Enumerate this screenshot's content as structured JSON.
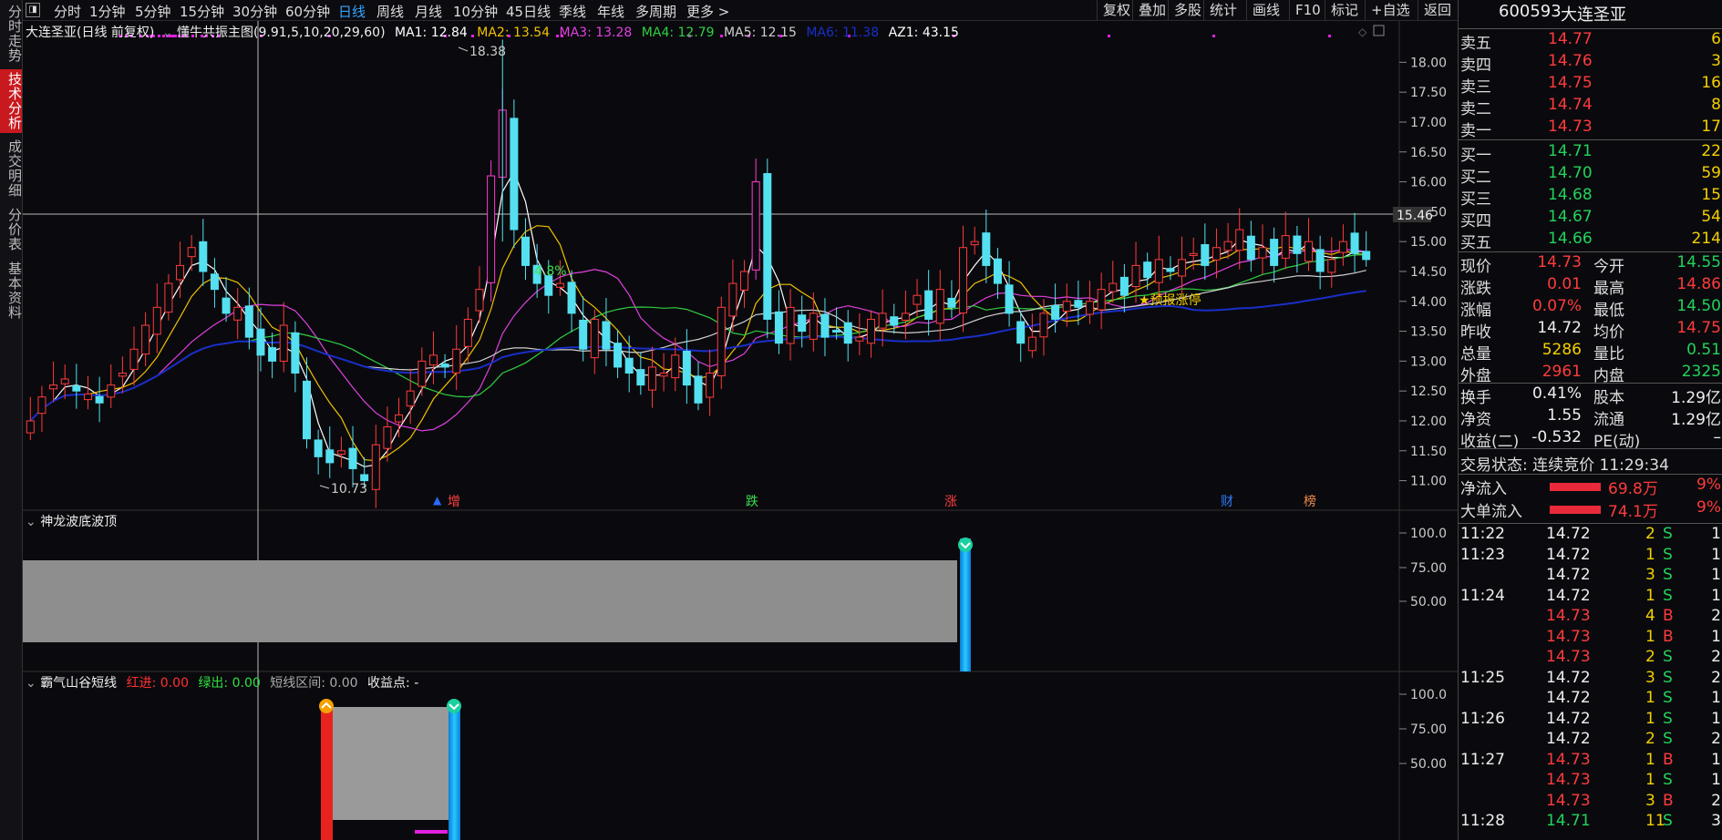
{
  "left_tabs": [
    "分时走势",
    "技术分析",
    "成交明细",
    "分价表",
    "基本资料"
  ],
  "topbar": {
    "periods": [
      "分时",
      "1分钟",
      "5分钟",
      "15分钟",
      "30分钟",
      "60分钟",
      "日线",
      "周线",
      "月线",
      "10分钟",
      "45日线",
      "季线",
      "年线",
      "多周期",
      "更多 >"
    ],
    "selected": "日线",
    "right_buttons": [
      "复权",
      "叠加",
      "多股",
      "统计",
      "画线",
      "F10",
      "标记",
      "+自选",
      "返回"
    ]
  },
  "main_chart": {
    "stock_name": "大连圣亚(日线 前复权)",
    "indicator": "懂牛共振主图(9.91,5,10,20,29,60)",
    "ma": [
      {
        "label": "MA1: 12.84",
        "color": "#ffffff"
      },
      {
        "label": "MA2: 13.54",
        "color": "#f0c000"
      },
      {
        "label": "MA3: 13.28",
        "color": "#e040e0"
      },
      {
        "label": "MA4: 12.79",
        "color": "#30d040"
      },
      {
        "label": "MA5: 12.15",
        "color": "#d0d0d0"
      },
      {
        "label": "MA6: 11.38",
        "color": "#1a2ec8"
      },
      {
        "label": "AZ1: 43.15",
        "color": "#ffffff"
      }
    ],
    "y_axis": [
      "18.00",
      "17.50",
      "17.00",
      "16.50",
      "16.00",
      "15.50",
      "15.00",
      "14.50",
      "14.00",
      "13.50",
      "13.00",
      "12.50",
      "12.00",
      "11.50",
      "11.00"
    ],
    "current_price_tag": "15.46",
    "high_label": "18.38",
    "low_label": "10.73",
    "pct_label": "4.8%",
    "signal_text": "★预报涨停",
    "bottom_markers": [
      "增",
      "跌",
      "涨",
      "财",
      "榜"
    ]
  },
  "pane2": {
    "title": "神龙波底波顶",
    "y_axis": [
      "100.0",
      "75.00",
      "50.00"
    ]
  },
  "pane3": {
    "title": "霸气山谷短线",
    "red_label": "红进: 0.00",
    "green_label": "绿出: 0.00",
    "range_label": "短线区间: 0.00",
    "profit_label": "收益点: -",
    "y_axis": [
      "100.0",
      "75.00",
      "50.00"
    ]
  },
  "quote": {
    "code": "600593",
    "name": "大连圣亚",
    "sell": [
      {
        "label": "卖五",
        "price": "14.77",
        "vol": "6"
      },
      {
        "label": "卖四",
        "price": "14.76",
        "vol": "3"
      },
      {
        "label": "卖三",
        "price": "14.75",
        "vol": "16"
      },
      {
        "label": "卖二",
        "price": "14.74",
        "vol": "8"
      },
      {
        "label": "卖一",
        "price": "14.73",
        "vol": "17"
      }
    ],
    "buy": [
      {
        "label": "买一",
        "price": "14.71",
        "vol": "22"
      },
      {
        "label": "买二",
        "price": "14.70",
        "vol": "59"
      },
      {
        "label": "买三",
        "price": "14.68",
        "vol": "15"
      },
      {
        "label": "买四",
        "price": "14.67",
        "vol": "54"
      },
      {
        "label": "买五",
        "price": "14.66",
        "vol": "214"
      }
    ],
    "stats": [
      {
        "l1": "现价",
        "v1": "14.73",
        "c1": "red",
        "l2": "今开",
        "v2": "14.55",
        "c2": "green"
      },
      {
        "l1": "涨跌",
        "v1": "0.01",
        "c1": "red",
        "l2": "最高",
        "v2": "14.86",
        "c2": "red"
      },
      {
        "l1": "涨幅",
        "v1": "0.07%",
        "c1": "red",
        "l2": "最低",
        "v2": "14.50",
        "c2": "green"
      },
      {
        "l1": "昨收",
        "v1": "14.72",
        "c1": "wht",
        "l2": "均价",
        "v2": "14.75",
        "c2": "red"
      },
      {
        "l1": "总量",
        "v1": "5286",
        "c1": "yel",
        "l2": "量比",
        "v2": "0.51",
        "c2": "green"
      },
      {
        "l1": "外盘",
        "v1": "2961",
        "c1": "red",
        "l2": "内盘",
        "v2": "2325",
        "c2": "green"
      }
    ],
    "stats2": [
      {
        "l1": "换手",
        "v1": "0.41%",
        "l2": "股本",
        "v2": "1.29亿"
      },
      {
        "l1": "净资",
        "v1": "1.55",
        "l2": "流通",
        "v2": "1.29亿"
      },
      {
        "l1": "收益(二)",
        "v1": "-0.532",
        "l2": "PE(动)",
        "v2": "–"
      }
    ],
    "trade_status": "交易状态: 连续竞价 11:29:34",
    "flows": [
      {
        "label": "净流入",
        "value": "69.8万",
        "pct": "9%"
      },
      {
        "label": "大单流入",
        "value": "74.1万",
        "pct": "9%"
      }
    ],
    "ticks": [
      {
        "time": "11:22",
        "price": "14.72",
        "pc": "wht",
        "vol": "2",
        "bs": "S",
        "n": "1"
      },
      {
        "time": "11:23",
        "price": "14.72",
        "pc": "wht",
        "vol": "1",
        "bs": "S",
        "n": "1"
      },
      {
        "time": "",
        "price": "14.72",
        "pc": "wht",
        "vol": "3",
        "bs": "S",
        "n": "1"
      },
      {
        "time": "11:24",
        "price": "14.72",
        "pc": "wht",
        "vol": "1",
        "bs": "S",
        "n": "1"
      },
      {
        "time": "",
        "price": "14.73",
        "pc": "red",
        "vol": "4",
        "bs": "B",
        "n": "2"
      },
      {
        "time": "",
        "price": "14.73",
        "pc": "red",
        "vol": "1",
        "bs": "B",
        "n": "1"
      },
      {
        "time": "",
        "price": "14.73",
        "pc": "red",
        "vol": "2",
        "bs": "S",
        "n": "2"
      },
      {
        "time": "11:25",
        "price": "14.72",
        "pc": "wht",
        "vol": "3",
        "bs": "S",
        "n": "2"
      },
      {
        "time": "",
        "price": "14.72",
        "pc": "wht",
        "vol": "1",
        "bs": "S",
        "n": "1"
      },
      {
        "time": "11:26",
        "price": "14.72",
        "pc": "wht",
        "vol": "1",
        "bs": "S",
        "n": "1"
      },
      {
        "time": "",
        "price": "14.72",
        "pc": "wht",
        "vol": "2",
        "bs": "S",
        "n": "2"
      },
      {
        "time": "11:27",
        "price": "14.73",
        "pc": "red",
        "vol": "1",
        "bs": "B",
        "n": "1"
      },
      {
        "time": "",
        "price": "14.73",
        "pc": "red",
        "vol": "1",
        "bs": "S",
        "n": "1"
      },
      {
        "time": "",
        "price": "14.73",
        "pc": "red",
        "vol": "3",
        "bs": "B",
        "n": "2"
      },
      {
        "time": "11:28",
        "price": "14.71",
        "pc": "green",
        "vol": "11",
        "bs": "S",
        "n": "3"
      }
    ]
  }
}
